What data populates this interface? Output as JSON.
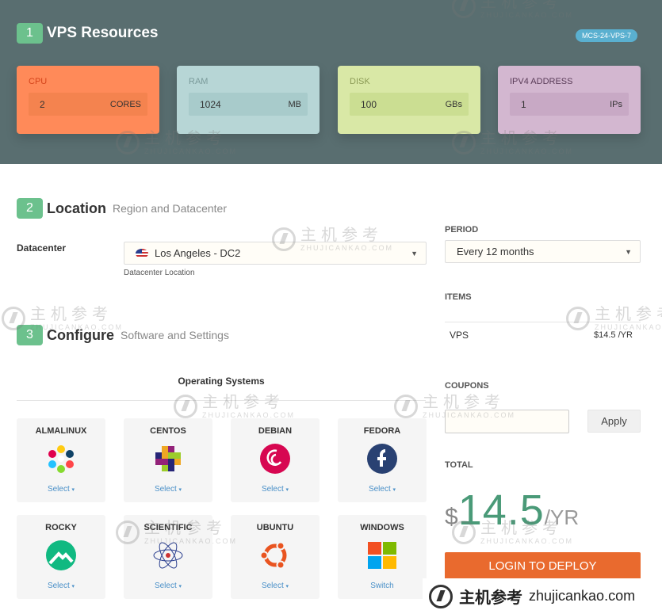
{
  "header": {
    "step": "1",
    "title": "VPS Resources",
    "plan_badge": "MCS-24-VPS-7"
  },
  "resources": [
    {
      "label": "CPU",
      "value": "2",
      "unit": "CORES",
      "bg": "#ff8a59",
      "box_bg": "#f4834f",
      "label_color": "#d4431a"
    },
    {
      "label": "RAM",
      "value": "1024",
      "unit": "MB",
      "bg": "#b7d6d6",
      "box_bg": "#a8cbcb",
      "label_color": "#7a9a9a"
    },
    {
      "label": "DISK",
      "value": "100",
      "unit": "GBs",
      "bg": "#d9e8a6",
      "box_bg": "#cbde92",
      "label_color": "#8b9a55"
    },
    {
      "label": "IPV4 ADDRESS",
      "value": "1",
      "unit": "IPs",
      "bg": "#d3b7d0",
      "box_bg": "#c8a9c5",
      "label_color": "#5a3c58"
    }
  ],
  "location": {
    "step": "2",
    "title": "Location",
    "subtitle": "Region and Datacenter",
    "datacenter_label": "Datacenter",
    "datacenter_value": "Los Angeles - DC2",
    "datacenter_hint": "Datacenter Location"
  },
  "configure": {
    "step": "3",
    "title": "Configure",
    "subtitle": "Software and Settings",
    "os_heading": "Operating Systems",
    "os_list": [
      {
        "name": "ALMALINUX",
        "action": "Select",
        "icon": "almalinux-logo-icon"
      },
      {
        "name": "CENTOS",
        "action": "Select",
        "icon": "centos-logo-icon"
      },
      {
        "name": "DEBIAN",
        "action": "Select",
        "icon": "debian-logo-icon"
      },
      {
        "name": "FEDORA",
        "action": "Select",
        "icon": "fedora-logo-icon"
      },
      {
        "name": "ROCKY",
        "action": "Select",
        "icon": "rocky-logo-icon"
      },
      {
        "name": "SCIENTIFIC",
        "action": "Select",
        "icon": "scientific-logo-icon"
      },
      {
        "name": "UBUNTU",
        "action": "Select",
        "icon": "ubuntu-logo-icon"
      },
      {
        "name": "WINDOWS",
        "action": "Switch",
        "icon": "windows-logo-icon"
      }
    ]
  },
  "summary": {
    "period_label": "PERIOD",
    "period_value": "Every 12 months",
    "items_label": "ITEMS",
    "item_name": "VPS",
    "item_price": "$14.5 /YR",
    "coupons_label": "COUPONS",
    "coupon_placeholder": "",
    "apply_label": "Apply",
    "total_label": "TOTAL",
    "total_currency": "$",
    "total_amount": "14.5",
    "total_period": "/YR",
    "deploy_label": "LOGIN TO DEPLOY"
  },
  "watermark": {
    "cn": "主机参考",
    "en": "ZHUJICANKAO.COM",
    "footer_cn": "主机参考",
    "footer_domain": "zhujicankao.com"
  }
}
